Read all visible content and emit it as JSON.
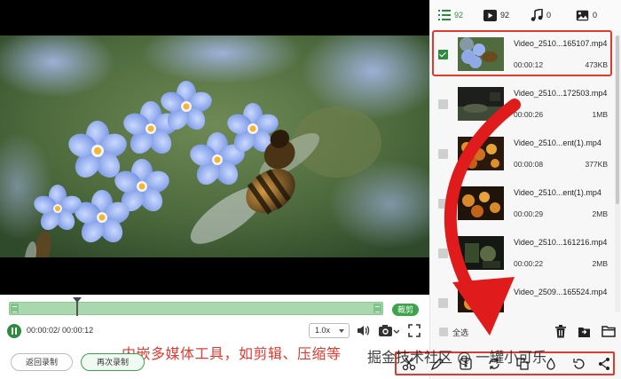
{
  "player": {
    "current_time": "00:00:02",
    "total_time": "/ 00:00:12",
    "cut_label": "裁剪",
    "speed_value": "1.0x"
  },
  "caption": "内嵌多媒体工具，如剪辑、压缩等",
  "buttons": {
    "back_label": "返回录制",
    "record_again_label": "再次录制"
  },
  "tabs": [
    {
      "icon": "list-icon",
      "count": "92"
    },
    {
      "icon": "video-icon",
      "count": "92"
    },
    {
      "icon": "music-icon",
      "count": "0"
    },
    {
      "icon": "image-icon",
      "count": "0"
    }
  ],
  "files": [
    {
      "name": "Video_2510...165107.mp4",
      "duration": "00:00:12",
      "size": "473KB",
      "checked": true
    },
    {
      "name": "Video_2510...172503.mp4",
      "duration": "00:00:26",
      "size": "1MB",
      "checked": false
    },
    {
      "name": "Video_2510...ent(1).mp4",
      "duration": "00:00:08",
      "size": "377KB",
      "checked": false
    },
    {
      "name": "Video_2510...ent(1).mp4",
      "duration": "00:00:29",
      "size": "2MB",
      "checked": false
    },
    {
      "name": "Video_2510...161216.mp4",
      "duration": "00:00:22",
      "size": "2MB",
      "checked": false
    },
    {
      "name": "Video_2509...165524.mp4",
      "duration": "",
      "size": "",
      "checked": false
    }
  ],
  "select_all_label": "全选",
  "watermark": "掘金技术社区 @ 一罐小可乐",
  "colors": {
    "accent_green": "#2e8b3d",
    "highlight_red": "#e03a2f",
    "timeline_green": "#a9d7ae"
  }
}
